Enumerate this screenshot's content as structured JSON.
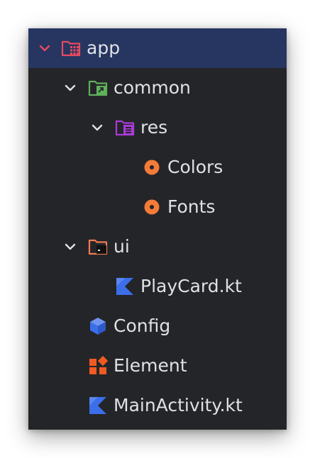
{
  "tree": {
    "app": {
      "label": "app",
      "icon": "module-folder-icon",
      "expanded": true,
      "selected": true
    },
    "common": {
      "label": "common",
      "icon": "package-folder-icon",
      "expanded": true
    },
    "res": {
      "label": "res",
      "icon": "resource-folder-icon",
      "expanded": true
    },
    "colors": {
      "label": "Colors",
      "icon": "resource-dot-icon"
    },
    "fonts": {
      "label": "Fonts",
      "icon": "resource-dot-icon"
    },
    "ui": {
      "label": "ui",
      "icon": "ui-folder-icon",
      "expanded": true
    },
    "playcard": {
      "label": "PlayCard.kt",
      "icon": "kotlin-file-icon"
    },
    "config": {
      "label": "Config",
      "icon": "config-cube-icon"
    },
    "element": {
      "label": "Element",
      "icon": "element-blocks-icon"
    },
    "mainactivity": {
      "label": "MainActivity.kt",
      "icon": "kotlin-file-icon"
    }
  },
  "colors": {
    "panel_background": "#242528",
    "selection_background": "#273561",
    "text": "#dfe1e5",
    "app_icon": "#e84a5f",
    "common_icon": "#5fb15a",
    "res_icon": "#a93bd6",
    "resource_dot": "#f47b39",
    "ui_icon": "#f07a52",
    "kotlin_icon": "#3c6eea",
    "config_icon": "#3c6eea",
    "element_icon": "#f15a22"
  }
}
